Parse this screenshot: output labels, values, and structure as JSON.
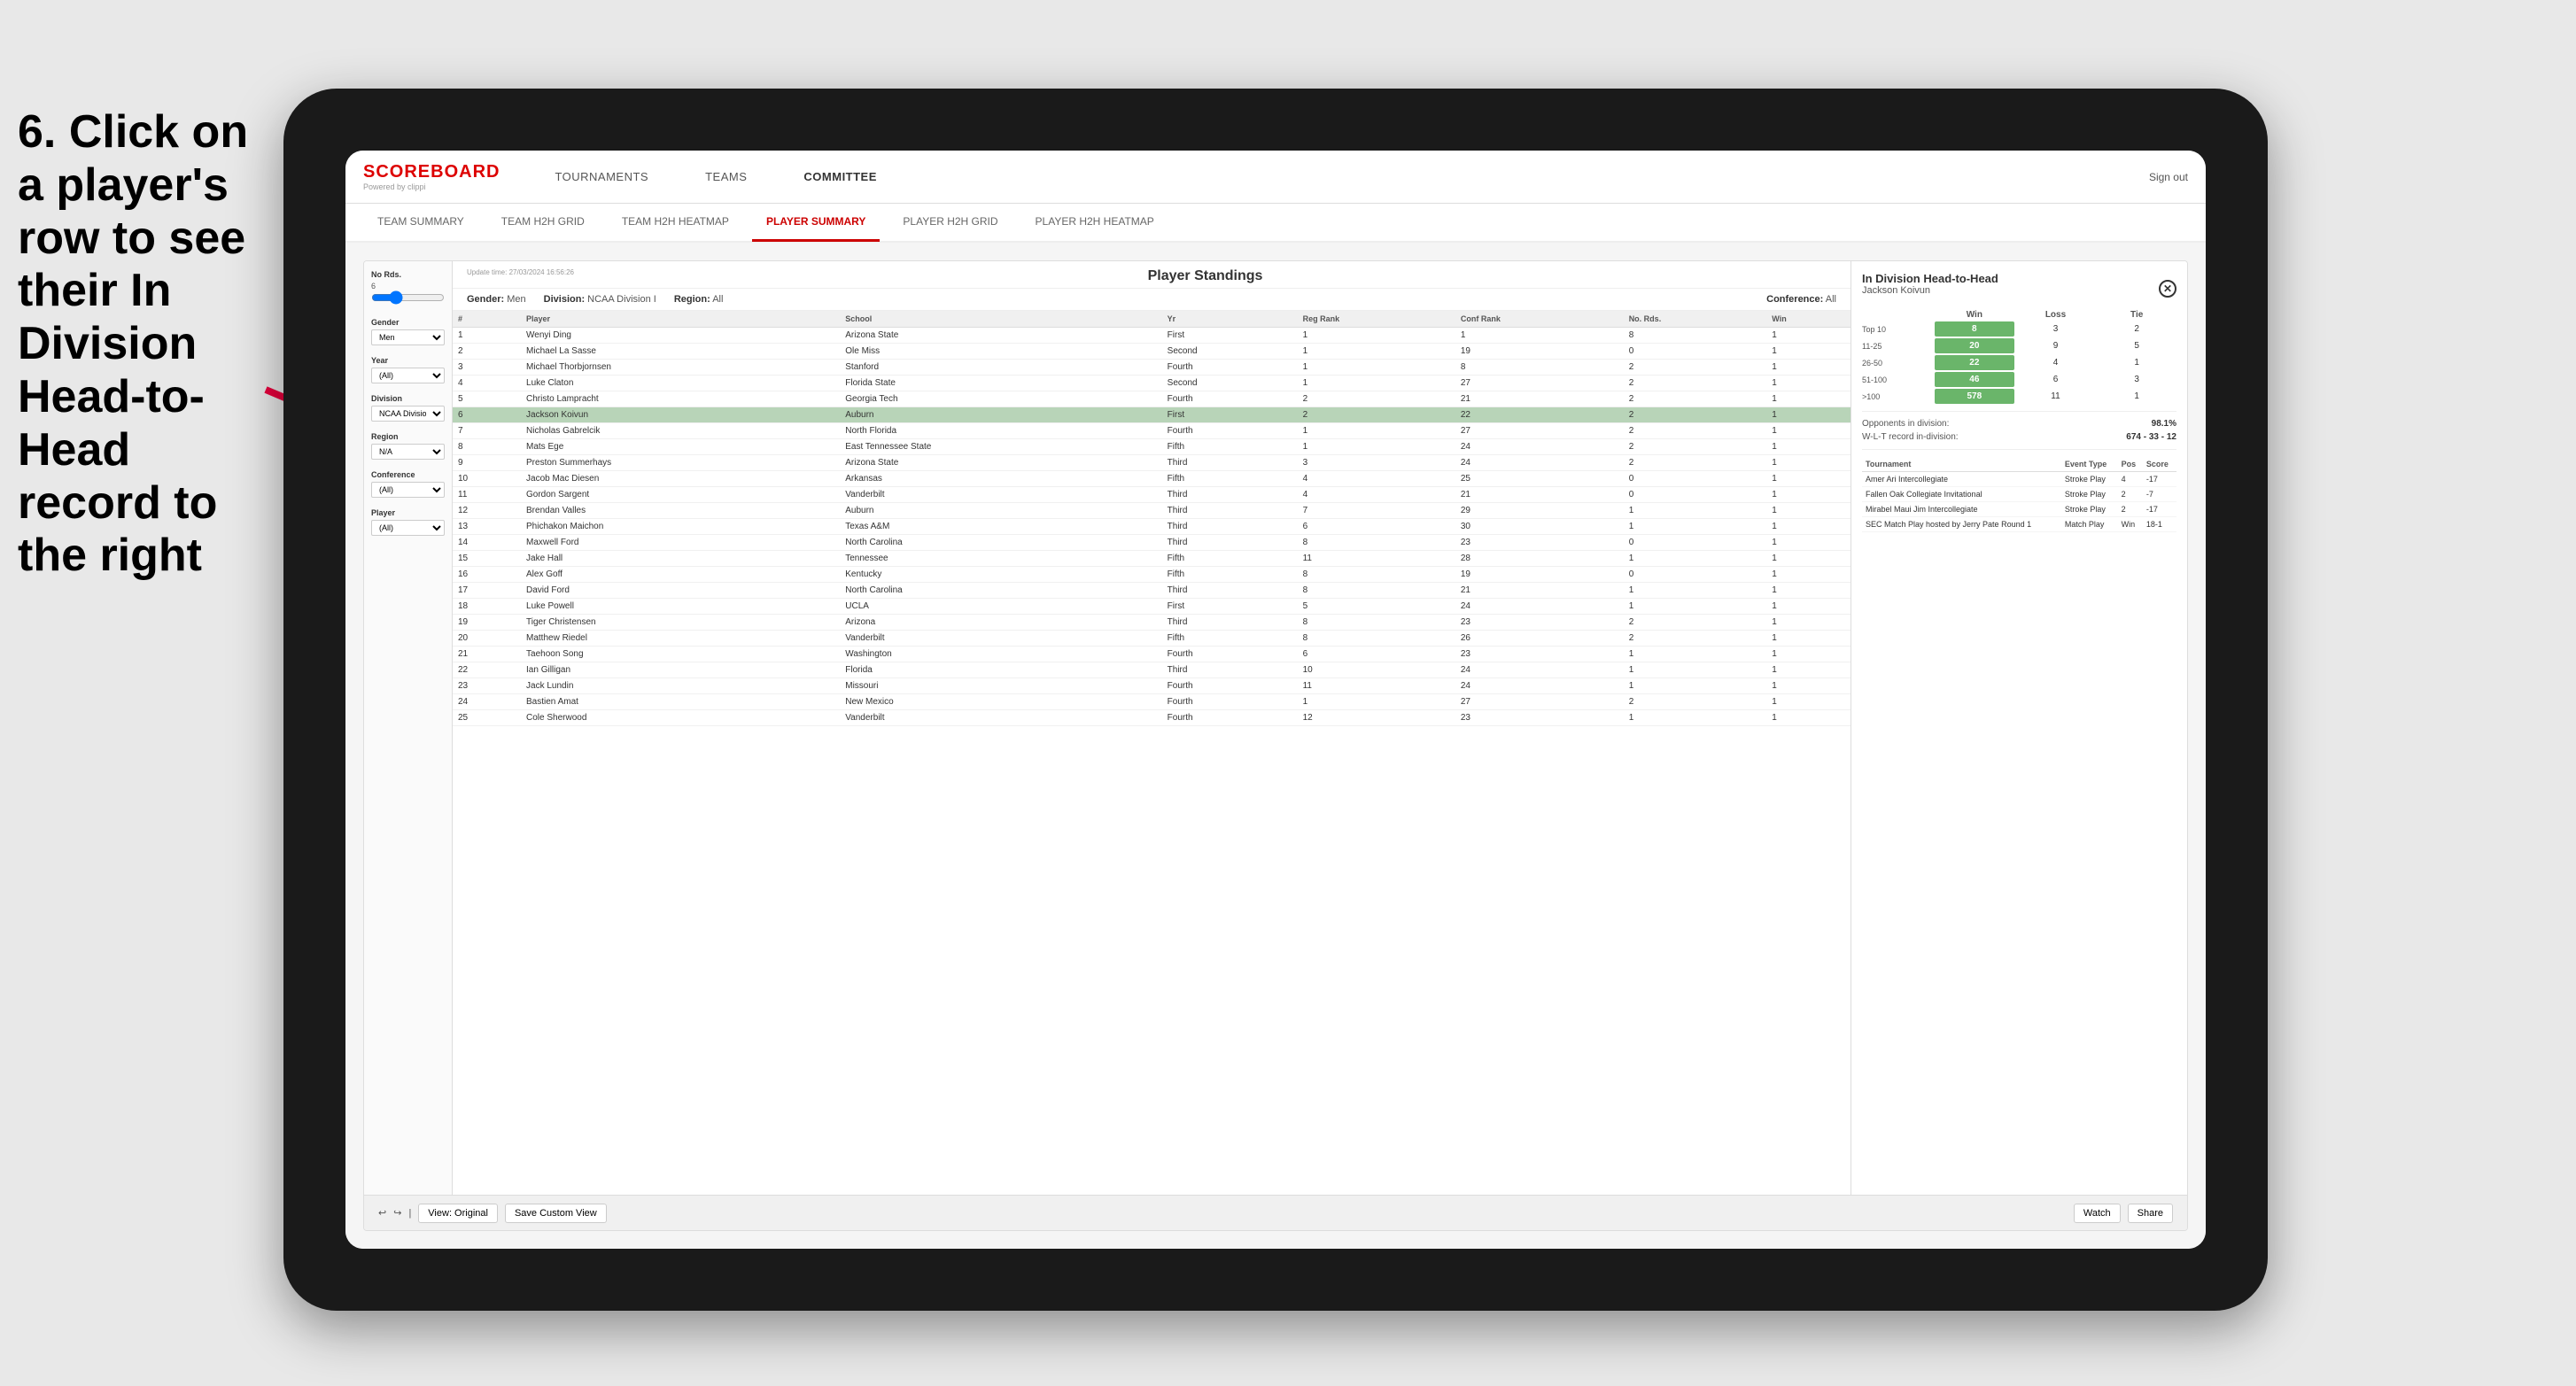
{
  "instruction": {
    "text": "6. Click on a player's row to see their In Division Head-to-Head record to the right"
  },
  "nav": {
    "logo": "SCOREBOARD",
    "logo_sub": "Powered by clippi",
    "items": [
      "TOURNAMENTS",
      "TEAMS",
      "COMMITTEE"
    ],
    "sign_out": "Sign out"
  },
  "sub_nav": {
    "items": [
      "TEAM SUMMARY",
      "TEAM H2H GRID",
      "TEAM H2H HEATMAP",
      "PLAYER SUMMARY",
      "PLAYER H2H GRID",
      "PLAYER H2H HEATMAP"
    ],
    "active": "PLAYER SUMMARY"
  },
  "toolbar": {
    "view_original": "View: Original",
    "save_custom": "Save Custom View",
    "watch": "Watch",
    "share": "Share"
  },
  "standings": {
    "title": "Player Standings",
    "update_time": "Update time:",
    "update_date": "27/03/2024 16:56:26",
    "gender_label": "Gender:",
    "gender_value": "Men",
    "division_label": "Division:",
    "division_value": "NCAA Division I",
    "region_label": "Region:",
    "region_value": "All",
    "conference_label": "Conference:",
    "conference_value": "All",
    "columns": [
      "#",
      "Player",
      "School",
      "Yr",
      "Reg Rank",
      "Conf Rank",
      "No. Rds.",
      "Win"
    ],
    "rows": [
      {
        "num": 1,
        "player": "Wenyi Ding",
        "school": "Arizona State",
        "yr": "First",
        "reg": 1,
        "conf": 1,
        "rds": 8,
        "win": 1
      },
      {
        "num": 2,
        "player": "Michael La Sasse",
        "school": "Ole Miss",
        "yr": "Second",
        "reg": 1,
        "conf": 19,
        "rds": 0,
        "win": 1
      },
      {
        "num": 3,
        "player": "Michael Thorbjornsen",
        "school": "Stanford",
        "yr": "Fourth",
        "reg": 1,
        "conf": 8,
        "rds": 2,
        "win": 1
      },
      {
        "num": 4,
        "player": "Luke Claton",
        "school": "Florida State",
        "yr": "Second",
        "reg": 1,
        "conf": 27,
        "rds": 2,
        "win": 1
      },
      {
        "num": 5,
        "player": "Christo Lampracht",
        "school": "Georgia Tech",
        "yr": "Fourth",
        "reg": 2,
        "conf": 21,
        "rds": 2,
        "win": 1
      },
      {
        "num": 6,
        "player": "Jackson Koivun",
        "school": "Auburn",
        "yr": "First",
        "reg": 2,
        "conf": 22,
        "rds": 2,
        "win": 1,
        "selected": true
      },
      {
        "num": 7,
        "player": "Nicholas Gabrelcik",
        "school": "North Florida",
        "yr": "Fourth",
        "reg": 1,
        "conf": 27,
        "rds": 2,
        "win": 1
      },
      {
        "num": 8,
        "player": "Mats Ege",
        "school": "East Tennessee State",
        "yr": "Fifth",
        "reg": 1,
        "conf": 24,
        "rds": 2,
        "win": 1
      },
      {
        "num": 9,
        "player": "Preston Summerhays",
        "school": "Arizona State",
        "yr": "Third",
        "reg": 3,
        "conf": 24,
        "rds": 2,
        "win": 1
      },
      {
        "num": 10,
        "player": "Jacob Mac Diesen",
        "school": "Arkansas",
        "yr": "Fifth",
        "reg": 4,
        "conf": 25,
        "rds": 0,
        "win": 1
      },
      {
        "num": 11,
        "player": "Gordon Sargent",
        "school": "Vanderbilt",
        "yr": "Third",
        "reg": 4,
        "conf": 21,
        "rds": 0,
        "win": 1
      },
      {
        "num": 12,
        "player": "Brendan Valles",
        "school": "Auburn",
        "yr": "Third",
        "reg": 7,
        "conf": 29,
        "rds": 1,
        "win": 1
      },
      {
        "num": 13,
        "player": "Phichakon Maichon",
        "school": "Texas A&M",
        "yr": "Third",
        "reg": 6,
        "conf": 30,
        "rds": 1,
        "win": 1
      },
      {
        "num": 14,
        "player": "Maxwell Ford",
        "school": "North Carolina",
        "yr": "Third",
        "reg": 8,
        "conf": 23,
        "rds": 0,
        "win": 1
      },
      {
        "num": 15,
        "player": "Jake Hall",
        "school": "Tennessee",
        "yr": "Fifth",
        "reg": 11,
        "conf": 28,
        "rds": 1,
        "win": 1
      },
      {
        "num": 16,
        "player": "Alex Goff",
        "school": "Kentucky",
        "yr": "Fifth",
        "reg": 8,
        "conf": 19,
        "rds": 0,
        "win": 1
      },
      {
        "num": 17,
        "player": "David Ford",
        "school": "North Carolina",
        "yr": "Third",
        "reg": 8,
        "conf": 21,
        "rds": 1,
        "win": 1
      },
      {
        "num": 18,
        "player": "Luke Powell",
        "school": "UCLA",
        "yr": "First",
        "reg": 5,
        "conf": 24,
        "rds": 1,
        "win": 1
      },
      {
        "num": 19,
        "player": "Tiger Christensen",
        "school": "Arizona",
        "yr": "Third",
        "reg": 8,
        "conf": 23,
        "rds": 2,
        "win": 1
      },
      {
        "num": 20,
        "player": "Matthew Riedel",
        "school": "Vanderbilt",
        "yr": "Fifth",
        "reg": 8,
        "conf": 26,
        "rds": 2,
        "win": 1
      },
      {
        "num": 21,
        "player": "Taehoon Song",
        "school": "Washington",
        "yr": "Fourth",
        "reg": 6,
        "conf": 23,
        "rds": 1,
        "win": 1
      },
      {
        "num": 22,
        "player": "Ian Gilligan",
        "school": "Florida",
        "yr": "Third",
        "reg": 10,
        "conf": 24,
        "rds": 1,
        "win": 1
      },
      {
        "num": 23,
        "player": "Jack Lundin",
        "school": "Missouri",
        "yr": "Fourth",
        "reg": 11,
        "conf": 24,
        "rds": 1,
        "win": 1
      },
      {
        "num": 24,
        "player": "Bastien Amat",
        "school": "New Mexico",
        "yr": "Fourth",
        "reg": 1,
        "conf": 27,
        "rds": 2,
        "win": 1
      },
      {
        "num": 25,
        "player": "Cole Sherwood",
        "school": "Vanderbilt",
        "yr": "Fourth",
        "reg": 12,
        "conf": 23,
        "rds": 1,
        "win": 1
      }
    ]
  },
  "filters": {
    "no_rds_label": "No Rds.",
    "no_rds_min": 6,
    "gender_label": "Gender",
    "gender_value": "Men",
    "year_label": "Year",
    "year_value": "(All)",
    "division_label": "Division",
    "division_value": "NCAA Division I",
    "region_label": "Region",
    "region_value": "N/A",
    "conference_label": "Conference",
    "conference_value": "(All)",
    "player_label": "Player",
    "player_value": "(All)"
  },
  "h2h": {
    "title": "In Division Head-to-Head",
    "player": "Jackson Koivun",
    "win_label": "Win",
    "loss_label": "Loss",
    "tie_label": "Tie",
    "rows": [
      {
        "range": "Top 10",
        "win": 8,
        "loss": 3,
        "tie": 2,
        "win_highlight": true
      },
      {
        "range": "11-25",
        "win": 20,
        "loss": 9,
        "tie": 5,
        "win_highlight": true
      },
      {
        "range": "26-50",
        "win": 22,
        "loss": 4,
        "tie": 1,
        "win_highlight": true
      },
      {
        "range": "51-100",
        "win": 46,
        "loss": 6,
        "tie": 3,
        "win_highlight": true
      },
      {
        "range": ">100",
        "win": 578,
        "loss": 11,
        "tie": 1,
        "win_highlight": true
      }
    ],
    "opponents_label": "Opponents in division:",
    "opponents_value": "98.1%",
    "wlt_label": "W-L-T record in-division:",
    "wlt_value": "674 - 33 - 12",
    "tournaments": {
      "headers": [
        "Tournament",
        "Event Type",
        "Pos",
        "Score"
      ],
      "rows": [
        {
          "tournament": "Amer Ari Intercollegiate",
          "event_type": "Stroke Play",
          "pos": 4,
          "score": "-17"
        },
        {
          "tournament": "Fallen Oak Collegiate Invitational",
          "event_type": "Stroke Play",
          "pos": 2,
          "score": "-7"
        },
        {
          "tournament": "Mirabel Maui Jim Intercollegiate",
          "event_type": "Stroke Play",
          "pos": 2,
          "score": "-17"
        },
        {
          "tournament": "SEC Match Play hosted by Jerry Pate Round 1",
          "event_type": "Match Play",
          "pos": "Win",
          "score": "18-1"
        }
      ]
    }
  }
}
